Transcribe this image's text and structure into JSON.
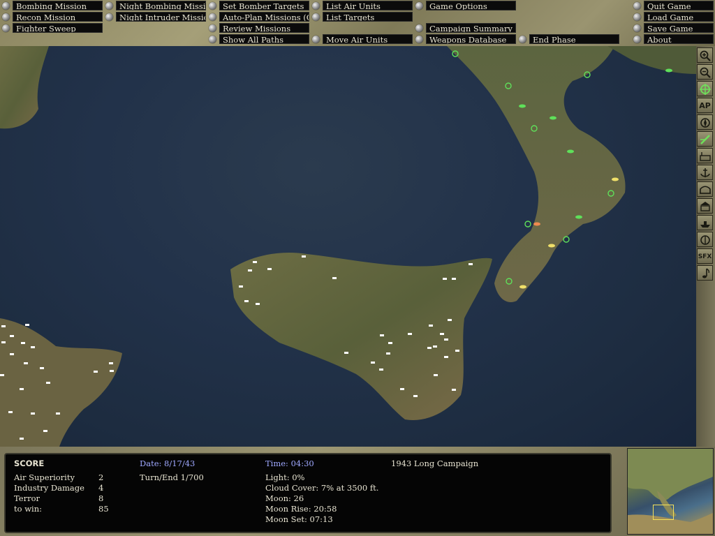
{
  "menu": {
    "bombing_mission": "Bombing Mission",
    "recon_mission": "Recon Mission",
    "fighter_sweep": "Fighter Sweep",
    "night_bombing_mission": "Night Bombing Mission",
    "night_intruder_mission": "Night Intruder Mission",
    "set_bomber_targets": "Set Bomber Targets",
    "auto_plan_missions": "Auto-Plan Missions (Off)",
    "review_missions": "Review Missions",
    "show_all_paths": "Show All Paths",
    "list_air_units": "List Air Units",
    "list_targets": "List Targets",
    "move_air_units": "Move Air Units",
    "game_options": "Game Options",
    "campaign_summary": "Campaign Summary",
    "weapons_database": "Weapons Database",
    "end_phase": "End Phase",
    "quit_game": "Quit Game",
    "load_game": "Load Game",
    "save_game": "Save Game",
    "about": "About"
  },
  "toolbar": {
    "zoom_in_icon": "magnifier-plus-icon",
    "zoom_out_icon": "magnifier-minus-icon",
    "target_icon": "crosshair-icon",
    "ap_label": "AP",
    "sfx_label": "SFX",
    "active_color": "#6fe05a"
  },
  "status": {
    "score_heading": "SCORE",
    "air_superiority_label": "Air Superiority",
    "air_superiority_value": "2",
    "industry_damage_label": "Industry Damage",
    "industry_damage_value": "4",
    "terror_label": "Terror",
    "terror_value": "8",
    "to_win_label": "to win:",
    "to_win_value": "85",
    "date": "Date: 8/17/43",
    "turn_end": "Turn/End 1/700",
    "time": "Time: 04:30",
    "light": "Light: 0%",
    "cloud_cover": "Cloud Cover: 7% at 3500 ft.",
    "moon": "Moon: 26",
    "moon_rise": "Moon Rise: 20:58",
    "moon_set": "Moon Set: 07:13",
    "campaign": "1943 Long Campaign"
  },
  "colors": {
    "date_time_text": "#9fa8ff",
    "airbase_allied": "#5fe05a",
    "unit_axis": "#f0e06a",
    "unit_axis_alt": "#f08a50",
    "target_marker": "#ffffff"
  }
}
